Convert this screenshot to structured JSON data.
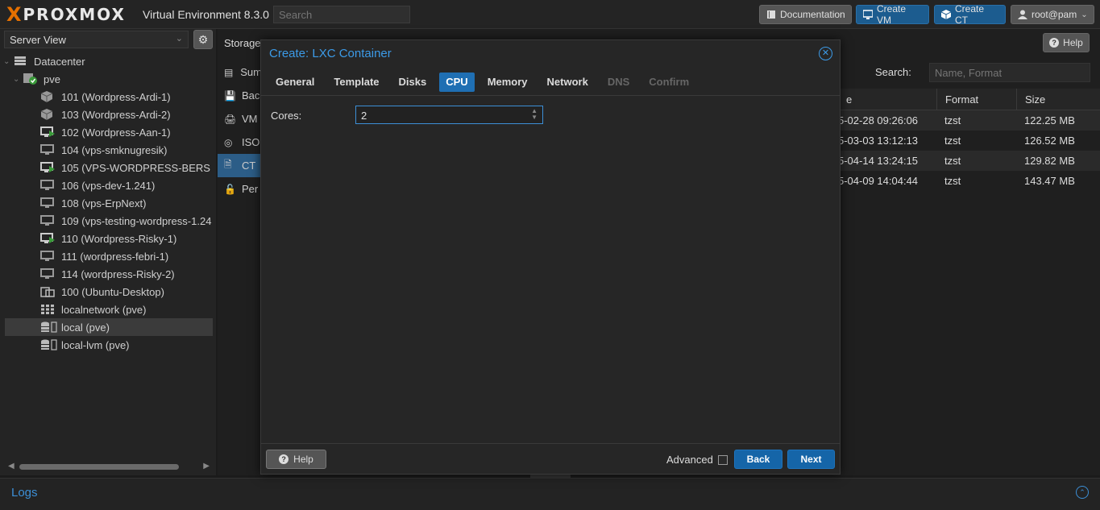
{
  "header": {
    "logo_x": "X",
    "logo_word": "PROXMOX",
    "product": "Virtual Environment 8.3.0",
    "search_placeholder": "Search",
    "documentation_label": "Documentation",
    "create_vm_label": "Create VM",
    "create_ct_label": "Create CT",
    "user_label": "root@pam"
  },
  "sidebar": {
    "view_label": "Server View",
    "items": [
      {
        "label": "Datacenter",
        "icon": "datacenter-icon"
      },
      {
        "label": "pve",
        "icon": "node-icon"
      },
      {
        "label": "101 (Wordpress-Ardi-1)",
        "icon": "container-icon"
      },
      {
        "label": "103 (Wordpress-Ardi-2)",
        "icon": "container-icon"
      },
      {
        "label": "102 (Wordpress-Aan-1)",
        "icon": "vm-running-icon"
      },
      {
        "label": "104 (vps-smknugresik)",
        "icon": "vm-icon"
      },
      {
        "label": "105 (VPS-WORDPRESS-BERS",
        "icon": "vm-running-icon"
      },
      {
        "label": "106 (vps-dev-1.241)",
        "icon": "vm-icon"
      },
      {
        "label": "108 (vps-ErpNext)",
        "icon": "vm-icon"
      },
      {
        "label": "109 (vps-testing-wordpress-1.24",
        "icon": "vm-icon"
      },
      {
        "label": "110 (Wordpress-Risky-1)",
        "icon": "vm-running-icon"
      },
      {
        "label": "111 (wordpress-febri-1)",
        "icon": "vm-icon"
      },
      {
        "label": "114 (wordpress-Risky-2)",
        "icon": "vm-icon"
      },
      {
        "label": "100 (Ubuntu-Desktop)",
        "icon": "template-icon"
      },
      {
        "label": "localnetwork (pve)",
        "icon": "network-icon"
      },
      {
        "label": "local (pve)",
        "icon": "storage-icon"
      },
      {
        "label": "local-lvm (pve)",
        "icon": "storage-icon"
      }
    ]
  },
  "storage": {
    "header": "Storage",
    "nav": [
      "Sum",
      "Bac",
      "VM",
      "ISO",
      "CT",
      "Per"
    ],
    "help_label": "Help",
    "search_label": "Search:",
    "search_placeholder": "Name, Format",
    "columns": [
      "e",
      "Format",
      "Size"
    ],
    "rows": [
      {
        "date": "5-02-28 09:26:06",
        "format": "tzst",
        "size": "122.25 MB"
      },
      {
        "date": "5-03-03 13:12:13",
        "format": "tzst",
        "size": "126.52 MB"
      },
      {
        "date": "5-04-14 13:24:15",
        "format": "tzst",
        "size": "129.82 MB"
      },
      {
        "date": "5-04-09 14:04:44",
        "format": "tzst",
        "size": "143.47 MB"
      }
    ]
  },
  "dialog": {
    "title": "Create: LXC Container",
    "tabs": [
      {
        "label": "General",
        "state": "normal"
      },
      {
        "label": "Template",
        "state": "normal"
      },
      {
        "label": "Disks",
        "state": "normal"
      },
      {
        "label": "CPU",
        "state": "active"
      },
      {
        "label": "Memory",
        "state": "normal"
      },
      {
        "label": "Network",
        "state": "normal"
      },
      {
        "label": "DNS",
        "state": "disabled"
      },
      {
        "label": "Confirm",
        "state": "disabled"
      }
    ],
    "cores_label": "Cores:",
    "cores_value": "2",
    "help_label": "Help",
    "advanced_label": "Advanced",
    "back_label": "Back",
    "next_label": "Next"
  },
  "logs": {
    "label": "Logs"
  },
  "colors": {
    "accent": "#1f6fb3",
    "brand": "#e57000",
    "link": "#3c9be8"
  }
}
